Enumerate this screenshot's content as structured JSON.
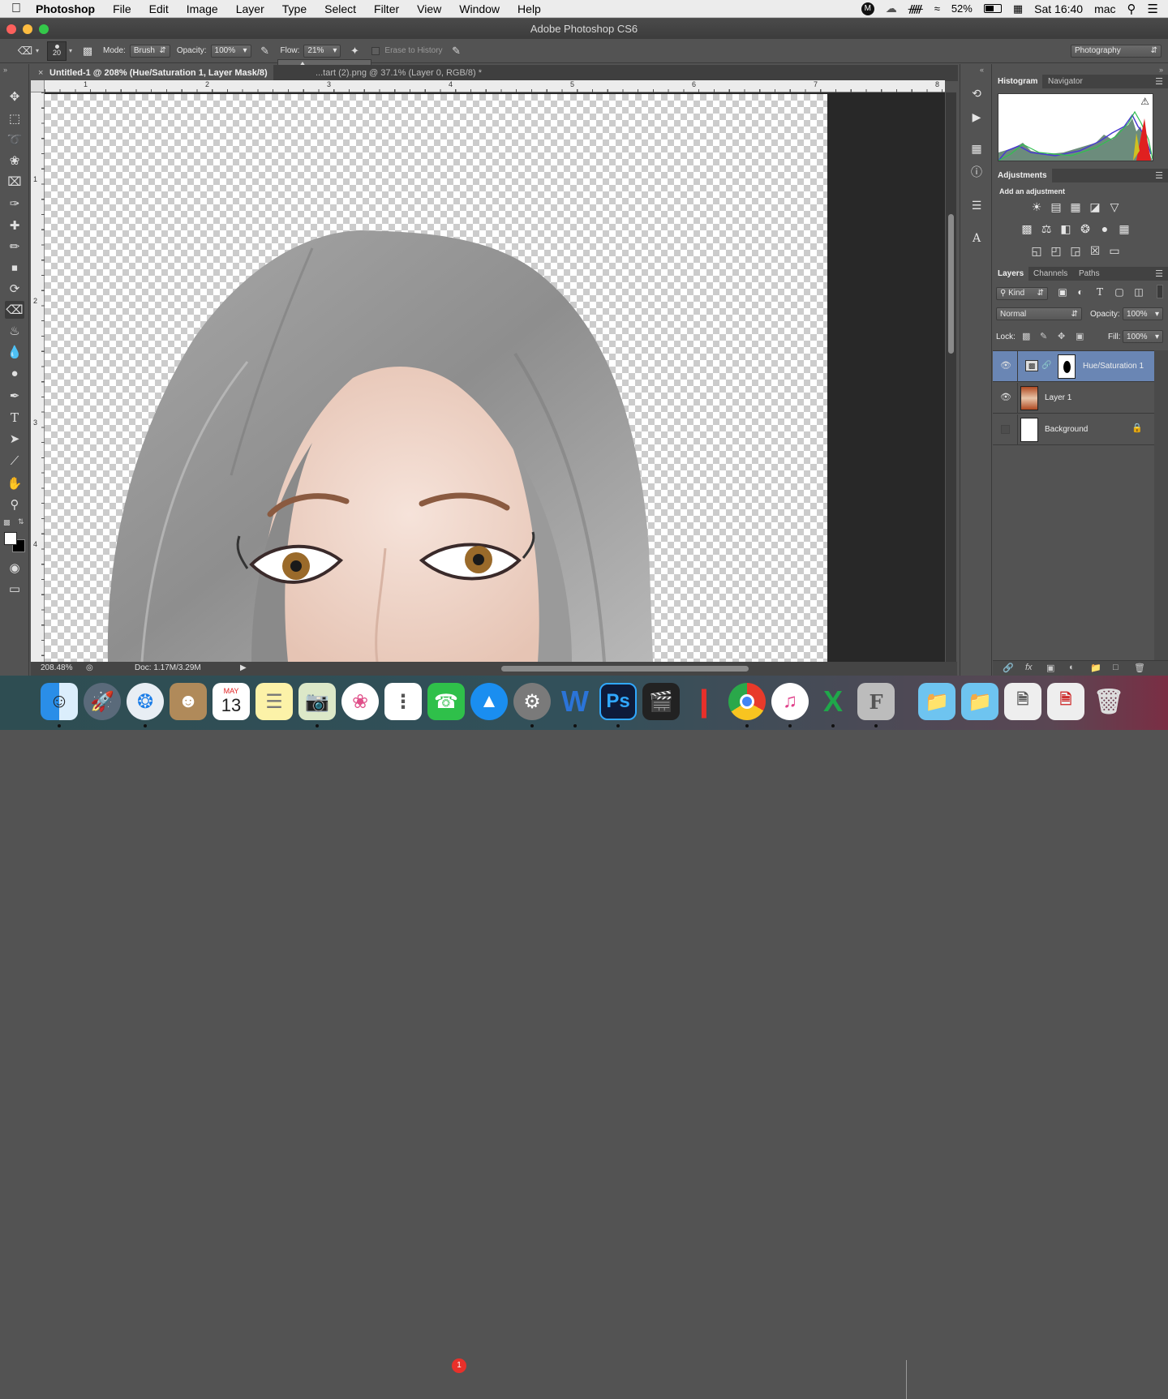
{
  "menubar": {
    "apple": "",
    "app_name": "Photoshop",
    "menus": [
      "File",
      "Edit",
      "Image",
      "Layer",
      "Type",
      "Select",
      "Filter",
      "View",
      "Window",
      "Help"
    ],
    "battery": "52%",
    "clock": "Sat 16:40",
    "user": "mac"
  },
  "window": {
    "title": "Adobe Photoshop CS6"
  },
  "options": {
    "brush_size": "20",
    "mode_label": "Mode:",
    "mode_value": "Brush",
    "opacity_label": "Opacity:",
    "opacity_value": "100%",
    "flow_label": "Flow:",
    "flow_value": "21%",
    "erase_history": "Erase to History",
    "workspace": "Photography"
  },
  "document": {
    "tabs": [
      {
        "title": "Untitled-1 @ 208% (Hue/Saturation 1, Layer Mask/8) *"
      },
      {
        "title": "...tart (2).png @ 37.1% (Layer 0, RGB/8) *"
      }
    ],
    "ruler_h": [
      "1",
      "2",
      "3",
      "4",
      "5",
      "6",
      "7",
      "8"
    ],
    "ruler_v": [
      "1",
      "2",
      "3",
      "4"
    ],
    "zoom": "208.48%",
    "doc_info": "Doc: 1.17M/3.29M"
  },
  "panels": {
    "histogram": {
      "tabs": [
        "Histogram",
        "Navigator"
      ]
    },
    "adjustments": {
      "tab": "Adjustments",
      "heading": "Add an adjustment"
    },
    "layers": {
      "tabs": [
        "Layers",
        "Channels",
        "Paths"
      ],
      "kind_label": "Kind",
      "blend_mode": "Normal",
      "opacity_label": "Opacity:",
      "opacity_value": "100%",
      "lock_label": "Lock:",
      "fill_label": "Fill:",
      "fill_value": "100%",
      "items": [
        {
          "name": "Hue/Saturation 1",
          "visible": true,
          "selected": true
        },
        {
          "name": "Layer 1",
          "visible": true,
          "selected": false
        },
        {
          "name": "Background",
          "visible": false,
          "selected": false
        }
      ]
    }
  },
  "dock": {
    "calendar_month": "MAY",
    "calendar_day": "13",
    "facetime_badge": "1",
    "apps": [
      "Finder",
      "Launchpad",
      "Safari",
      "Contacts",
      "Calendar",
      "Notes",
      "Preview",
      "Photos",
      "Reminders",
      "FaceTime",
      "App Store",
      "System Preferences",
      "Word",
      "Photoshop",
      "Final Cut Pro",
      "Pages",
      "Chrome",
      "iTunes",
      "Excel",
      "Font",
      "Folder",
      "Folder",
      "Document",
      "Document",
      "Trash"
    ],
    "word_letter": "W",
    "ps_letters": "Ps",
    "excel_letter": "X",
    "font_letter": "F"
  }
}
